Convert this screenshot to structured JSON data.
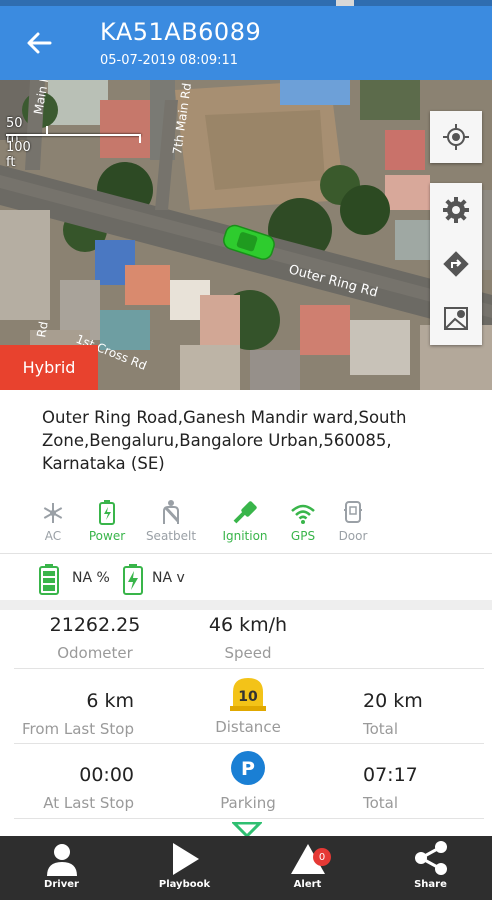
{
  "header": {
    "title": "KA51AB6089",
    "timestamp": "05-07-2019 08:09:11",
    "back_icon": "arrow-left-icon",
    "color": "#3b8be0"
  },
  "map": {
    "scale_metric": "50 m",
    "scale_imperial": "100 ft",
    "road_labels": [
      "7th Main Rd",
      "Outer Ring Rd",
      "1st Cross Rd",
      "Main Rd",
      "Rd"
    ],
    "map_type_label": "Hybrid",
    "buttons": [
      "locate-icon",
      "gear-icon",
      "directions-icon",
      "map-pin-icon"
    ],
    "vehicle_color": "#2ecc2e"
  },
  "address": "Outer Ring Road,Ganesh Mandir ward,South Zone,Bengaluru,Bangalore Urban,560085, Karnataka (SE)",
  "features": [
    {
      "label": "AC",
      "icon": "snowflake-icon",
      "active": false
    },
    {
      "label": "Power",
      "icon": "battery-icon",
      "active": true
    },
    {
      "label": "Seatbelt",
      "icon": "seatbelt-icon",
      "active": false
    },
    {
      "label": "Ignition",
      "icon": "key-icon",
      "active": true
    },
    {
      "label": "GPS",
      "icon": "wifi-icon",
      "active": true
    },
    {
      "label": "Door",
      "icon": "door-icon",
      "active": false
    }
  ],
  "battery": {
    "percent": "NA %",
    "voltage": "NA v"
  },
  "stats": {
    "odometer_value": "21262.25",
    "odometer_label": "Odometer",
    "speed_value": "46 km/h",
    "speed_label": "Speed",
    "from_last_stop_value": "6 km",
    "from_last_stop_label": "From Last Stop",
    "distance_badge": "10",
    "distance_label": "Distance",
    "distance_total_value": "20 km",
    "distance_total_label": "Total",
    "at_last_stop_value": "00:00",
    "at_last_stop_label": "At Last Stop",
    "parking_badge": "P",
    "parking_label": "Parking",
    "parking_total_value": "07:17",
    "parking_total_label": "Total"
  },
  "bottom_nav": [
    {
      "label": "Driver",
      "icon": "person-icon"
    },
    {
      "label": "Playbook",
      "icon": "play-icon"
    },
    {
      "label": "Alert",
      "icon": "alert-icon",
      "badge": "0"
    },
    {
      "label": "Share",
      "icon": "share-icon"
    }
  ]
}
